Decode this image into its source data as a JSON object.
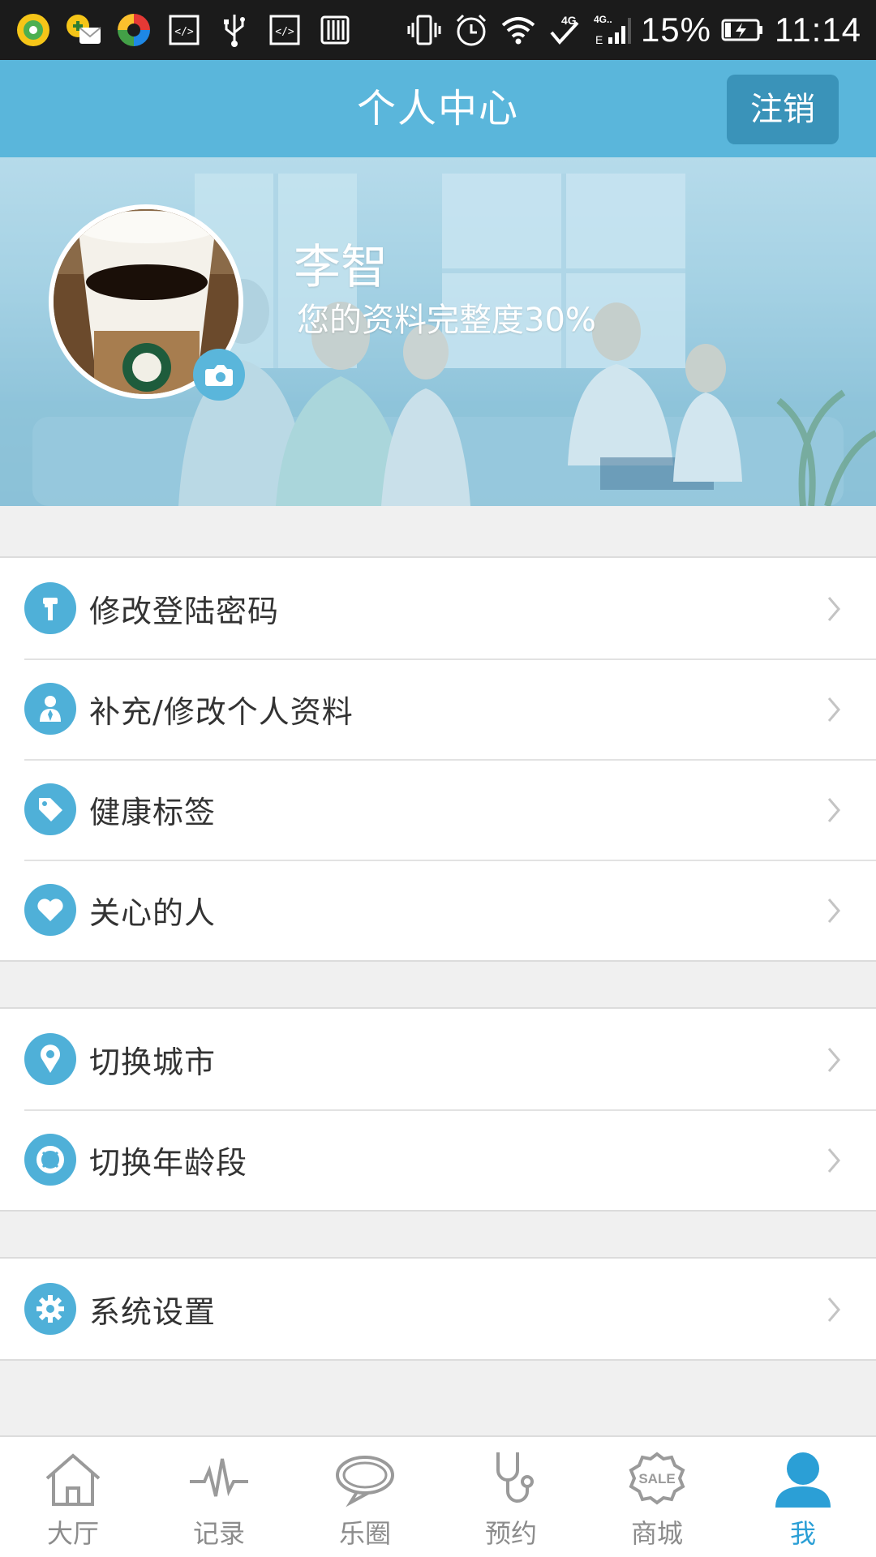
{
  "status_bar": {
    "battery": "15%",
    "time": "11:14",
    "network": "4G",
    "left_icons": [
      "app-icon-1",
      "app-icon-2",
      "app-icon-3",
      "code-icon",
      "usb-icon",
      "code-icon",
      "barcode-icon"
    ],
    "right_icons": [
      "vibrate-icon",
      "alarm-icon",
      "wifi-icon",
      "signal-icon",
      "battery-icon"
    ]
  },
  "header": {
    "title": "个人中心",
    "logout_label": "注销",
    "bg_color": "#5ab6db"
  },
  "profile": {
    "name": "李智",
    "completeness_text": "您的资料完整度30%",
    "completeness_value": 30
  },
  "menu": {
    "group1": [
      {
        "label": "修改登陆密码",
        "icon": "key-icon"
      },
      {
        "label": "补充/修改个人资料",
        "icon": "person-icon"
      },
      {
        "label": "健康标签",
        "icon": "tag-icon"
      },
      {
        "label": "关心的人",
        "icon": "heart-icon"
      }
    ],
    "group2": [
      {
        "label": "切换城市",
        "icon": "location-pin-icon"
      },
      {
        "label": "切换年龄段",
        "icon": "lifebuoy-icon"
      }
    ],
    "group3": [
      {
        "label": "系统设置",
        "icon": "gear-icon"
      }
    ]
  },
  "bottom_nav": [
    {
      "label": "大厅",
      "icon": "home-icon"
    },
    {
      "label": "记录",
      "icon": "heartbeat-icon"
    },
    {
      "label": "乐圈",
      "icon": "chat-bubble-icon"
    },
    {
      "label": "预约",
      "icon": "stethoscope-icon"
    },
    {
      "label": "商城",
      "icon": "sale-icon"
    },
    {
      "label": "我",
      "icon": "user-icon",
      "active": true
    }
  ],
  "colors": {
    "accent": "#5ab6db",
    "active_nav": "#2b9fd6",
    "logout_button": "#3a93b9"
  }
}
